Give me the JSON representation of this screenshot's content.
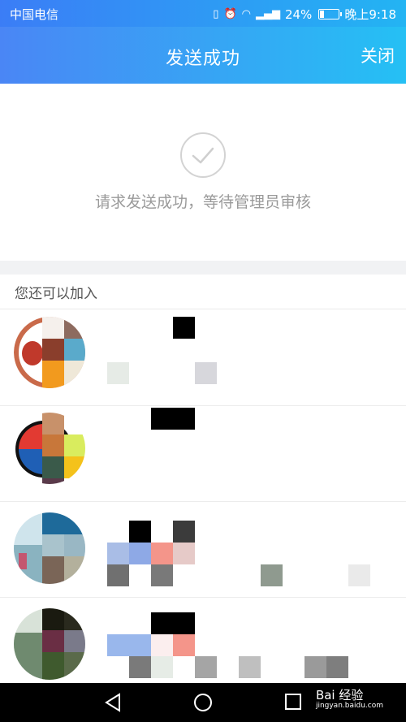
{
  "status_bar": {
    "carrier": "中国电信",
    "battery_text": "24%",
    "battery_level": 0.24,
    "time": "晚上9:18",
    "icons": [
      "vibrate-icon",
      "alarm-icon",
      "wifi-icon",
      "signal-4g-icon",
      "battery-icon"
    ]
  },
  "header": {
    "title": "发送成功",
    "close_label": "关闭"
  },
  "result": {
    "icon": "check-circle-icon",
    "message": "请求发送成功，等待管理员审核"
  },
  "suggestions": {
    "title": "您还可以加入",
    "groups": [
      {
        "avatar": "group-avatar-1"
      },
      {
        "avatar": "group-avatar-2"
      },
      {
        "avatar": "group-avatar-3"
      },
      {
        "avatar": "group-avatar-4"
      }
    ]
  },
  "nav_bar": {
    "icons": [
      "back-icon",
      "home-icon",
      "recents-icon"
    ],
    "watermark_brand": "Bai 经验",
    "watermark_url": "jingyan.baidu.com"
  },
  "colors": {
    "header_gradient_start": "#4a86f5",
    "header_gradient_end": "#25c0f4"
  }
}
